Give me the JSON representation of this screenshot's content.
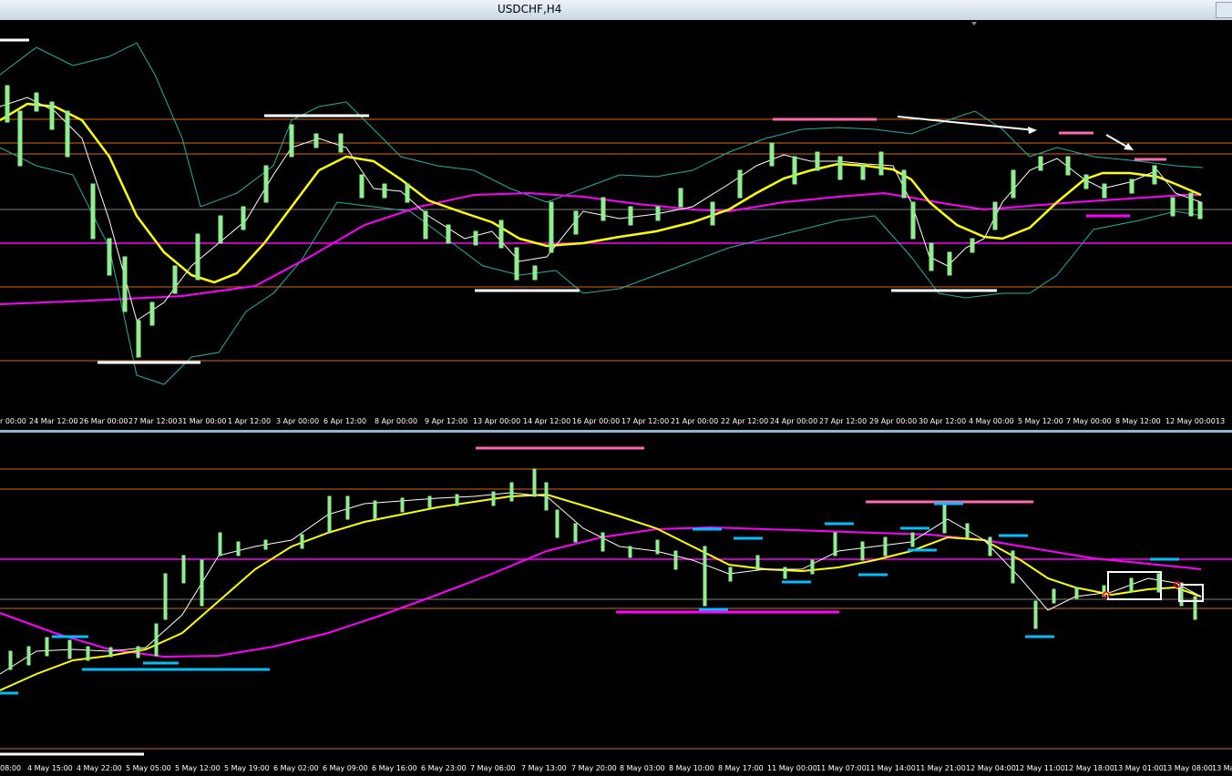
{
  "window": {
    "title": "USDCHF,H4"
  },
  "top_axis": [
    "r 00:00",
    "24 Mar 12:00",
    "26 Mar 00:00",
    "27 Mar 12:00",
    "31 Mar 00:00",
    "1 Apr 12:00",
    "3 Apr 00:00",
    "6 Apr 12:00",
    "8 Apr 00:00",
    "9 Apr 12:00",
    "13 Apr 00:00",
    "14 Apr 12:00",
    "16 Apr 00:00",
    "17 Apr 12:00",
    "21 Apr 00:00",
    "22 Apr 12:00",
    "24 Apr 00:00",
    "27 Apr 12:00",
    "29 Apr 00:00",
    "30 Apr 12:00",
    "4 May 00:00",
    "5 May 12:00",
    "7 May 00:00",
    "8 May 12:00",
    "12 May 00:00",
    "13"
  ],
  "bottom_axis": [
    "08:00",
    "4 May 15:00",
    "4 May 22:00",
    "5 May 05:00",
    "5 May 12:00",
    "5 May 19:00",
    "6 May 02:00",
    "6 May 09:00",
    "6 May 16:00",
    "6 May 23:00",
    "7 May 06:00",
    "7 May 13:00",
    "7 May 20:00",
    "8 May 03:00",
    "8 May 10:00",
    "8 May 17:00",
    "11 May 00:00",
    "11 May 07:00",
    "11 May 14:00",
    "11 May 21:00",
    "12 May 04:00",
    "12 May 11:00",
    "12 May 18:00",
    "13 May 01:00",
    "13 May 08:00",
    "13 Ma"
  ],
  "colors": {
    "candle": "#90ee90",
    "fast_ma": "#ffff00",
    "slow_ma": "#ff00ff",
    "bands": "#20b2aa",
    "level": "#d2691e"
  }
}
